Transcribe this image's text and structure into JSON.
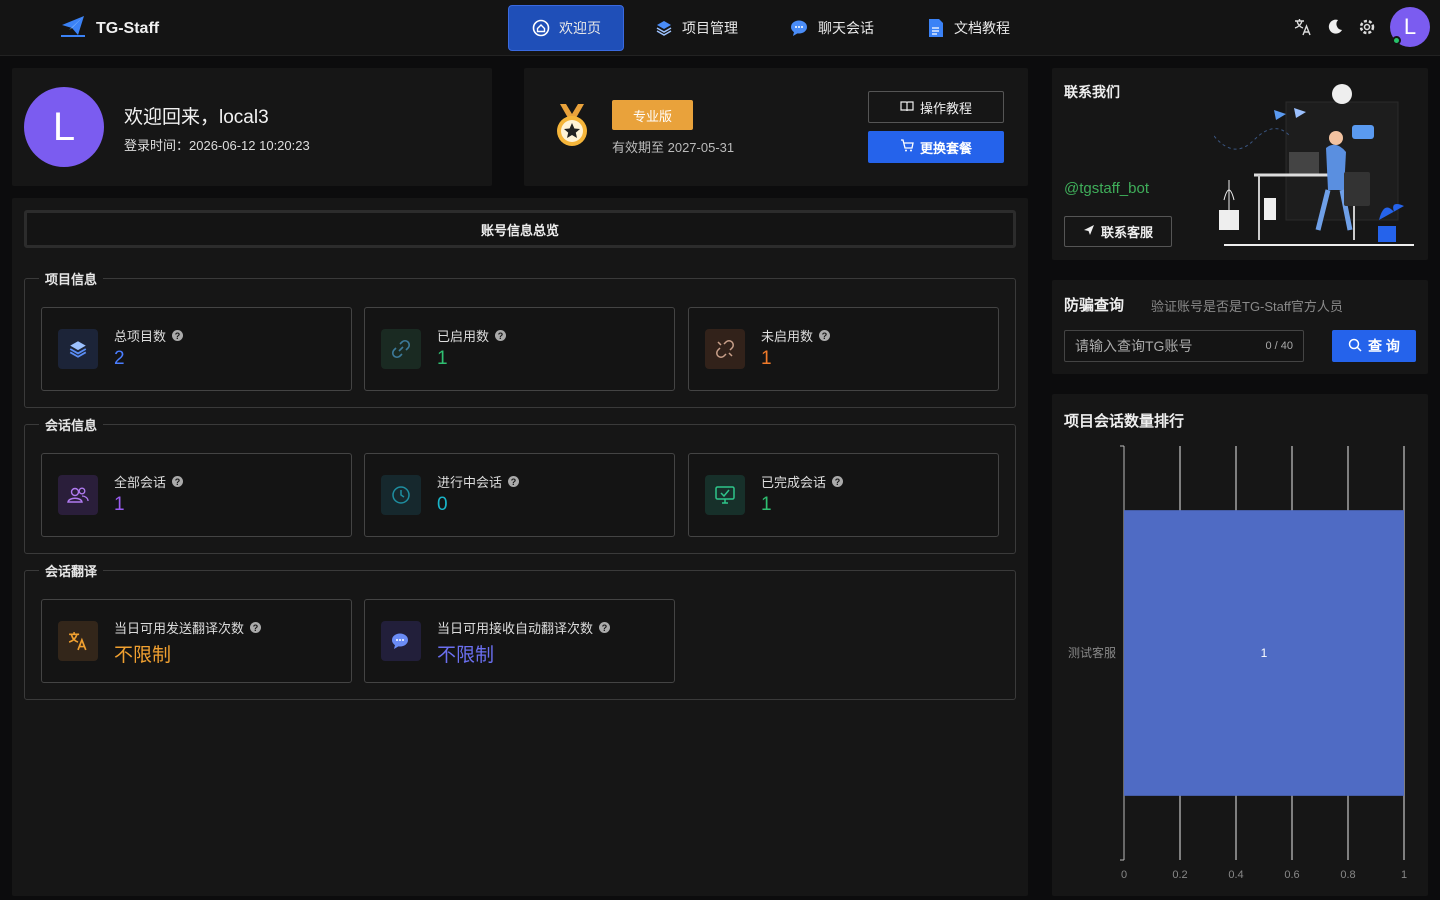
{
  "app": {
    "name": "TG-Staff"
  },
  "nav": {
    "items": [
      {
        "label": "欢迎页",
        "icon": "home-icon",
        "active": true
      },
      {
        "label": "项目管理",
        "icon": "layers-icon",
        "active": false
      },
      {
        "label": "聊天会话",
        "icon": "chat-icon",
        "active": false
      },
      {
        "label": "文档教程",
        "icon": "document-icon",
        "active": false
      }
    ]
  },
  "user": {
    "initial": "L",
    "welcome": "欢迎回来，local3",
    "login_time": "登录时间：2026-06-12 10:20:23"
  },
  "plan": {
    "badge": "专业版",
    "expire": "有效期至 2027-05-31",
    "tutorial_label": "操作教程",
    "change_label": "更换套餐"
  },
  "overview": {
    "header": "账号信息总览",
    "groups": [
      {
        "title": "项目信息",
        "cards": [
          {
            "label": "总项目数",
            "value": "2",
            "color": "#4a7dff",
            "icon": "layers-icon"
          },
          {
            "label": "已启用数",
            "value": "1",
            "color": "#2fbf71",
            "icon": "link-icon"
          },
          {
            "label": "未启用数",
            "value": "1",
            "color": "#f07a2a",
            "icon": "unlink-icon"
          }
        ]
      },
      {
        "title": "会话信息",
        "cards": [
          {
            "label": "全部会话",
            "value": "1",
            "color": "#9a5cf0",
            "icon": "users-icon"
          },
          {
            "label": "进行中会话",
            "value": "0",
            "color": "#19b5c9",
            "icon": "clock-icon"
          },
          {
            "label": "已完成会话",
            "value": "1",
            "color": "#2fbf71",
            "icon": "check-monitor-icon"
          }
        ]
      },
      {
        "title": "会话翻译",
        "cards": [
          {
            "label": "当日可用发送翻译次数",
            "value": "不限制",
            "color": "#f0a030",
            "icon": "translate-icon"
          },
          {
            "label": "当日可用接收自动翻译次数",
            "value": "不限制",
            "color": "#6b6ff0",
            "icon": "chat-bubbles-icon"
          }
        ]
      }
    ]
  },
  "contact": {
    "title": "联系我们",
    "bot": "@tgstaff_bot",
    "button_label": "联系客服"
  },
  "anti_fraud": {
    "title": "防骗查询",
    "subtitle": "验证账号是否是TG-Staff官方人员",
    "placeholder": "请输入查询TG账号",
    "count": "0 / 40",
    "button_label": "查 询"
  },
  "rank": {
    "title": "项目会话数量排行"
  },
  "chart_data": {
    "type": "bar",
    "orientation": "horizontal",
    "categories": [
      "测试客服"
    ],
    "values": [
      1
    ],
    "xlim": [
      0,
      1
    ],
    "xticks": [
      "0",
      "0.2",
      "0.4",
      "0.6",
      "0.8",
      "1"
    ],
    "data_labels": [
      "1"
    ],
    "color": "#4f6bc4",
    "grid": true
  }
}
